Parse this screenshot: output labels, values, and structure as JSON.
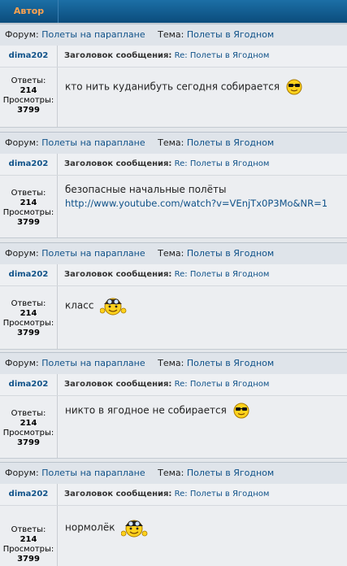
{
  "header": {
    "author_col": "Автор"
  },
  "labels": {
    "forum": "Форум:",
    "topic": "Тема:",
    "subject": "Заголовок сообщения:",
    "replies": "Ответы:",
    "views": "Просмотры:"
  },
  "posts": [
    {
      "forum": "Полеты на параплане",
      "topic": "Полеты в Ягодном",
      "author": "dima202",
      "subject": "Re: Полеты в Ягодном",
      "replies": "214",
      "views": "3799",
      "message": "кто нить куданибуть сегодня собирается",
      "link": "",
      "smiley": "cool-smiley-icon"
    },
    {
      "forum": "Полеты на параплане",
      "topic": "Полеты в Ягодном",
      "author": "dima202",
      "subject": "Re: Полеты в Ягодном",
      "replies": "214",
      "views": "3799",
      "message": "безопасные начальные полёты",
      "link": "http://www.youtube.com/watch?v=VEnjTx0P3Mo&NR=1",
      "smiley": ""
    },
    {
      "forum": "Полеты на параплане",
      "topic": "Полеты в Ягодном",
      "author": "dima202",
      "subject": "Re: Полеты в Ягодном",
      "replies": "214",
      "views": "3799",
      "message": "класс",
      "link": "",
      "smiley": "pilot-smiley-icon"
    },
    {
      "forum": "Полеты на параплане",
      "topic": "Полеты в Ягодном",
      "author": "dima202",
      "subject": "Re: Полеты в Ягодном",
      "replies": "214",
      "views": "3799",
      "message": "никто в ягодное не собирается",
      "link": "",
      "smiley": "cool-smiley-icon"
    },
    {
      "forum": "Полеты на параплане",
      "topic": "Полеты в Ягодном",
      "author": "dima202",
      "subject": "Re: Полеты в Ягодном",
      "replies": "214",
      "views": "3799",
      "message": "нормолёк",
      "link": "",
      "smiley": "pilot-smiley-icon"
    }
  ]
}
